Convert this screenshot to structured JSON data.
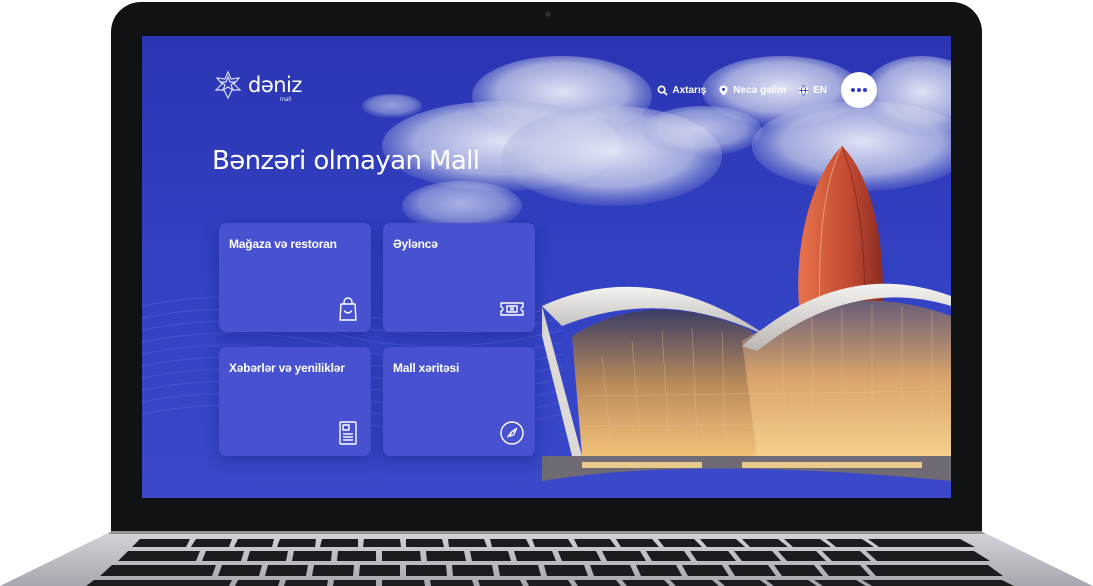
{
  "brand": {
    "name": "dəniz",
    "sub": "mall"
  },
  "nav": {
    "search": "Axtarış",
    "directions": "Necə gəlim",
    "language": "EN"
  },
  "hero": {
    "title": "Bənzəri olmayan Mall"
  },
  "cards": [
    {
      "label": "Mağaza və restoran",
      "icon": "shopping-bag-icon"
    },
    {
      "label": "Əyləncə",
      "icon": "ticket-icon"
    },
    {
      "label": "Xəbərlər və yeniliklər",
      "icon": "document-icon"
    },
    {
      "label": "Mall xəritəsi",
      "icon": "compass-icon"
    }
  ],
  "colors": {
    "background": "#2f3ec0",
    "card": "#4852d0",
    "accent": "#ffffff"
  }
}
